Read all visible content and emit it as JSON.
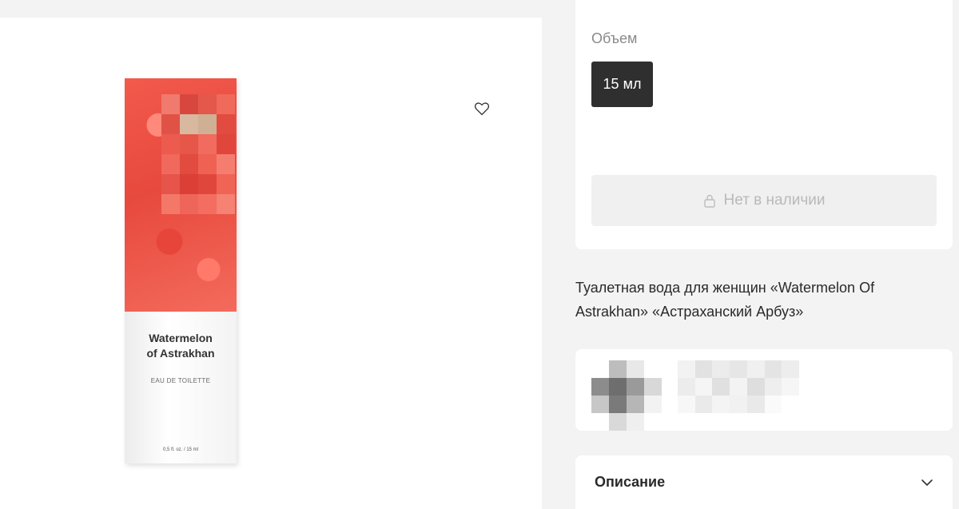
{
  "gallery": {
    "favorite_icon": "heart-outline-icon",
    "product_image": {
      "name_on_box": "Watermelon of Astrakhan",
      "name_line1": "Watermelon",
      "name_line2": "of Astrakhan",
      "type_on_box": "EAU DE TOILETTE",
      "volume_on_box": "0,5 fl. oz. / 15 ml"
    }
  },
  "purchase": {
    "volume_label": "Объем",
    "volume_options": [
      {
        "label": "15 мл",
        "selected": true
      }
    ],
    "stock_button": {
      "label": "Нет в наличии",
      "icon": "lock-icon",
      "disabled": true
    }
  },
  "product": {
    "title": "Туалетная вода для женщин «Watermelon Of Astrakhan» «Астраханский Арбуз»"
  },
  "description": {
    "label": "Описание",
    "icon": "chevron-down-icon"
  },
  "colors": {
    "chip_bg": "#2f2f2f",
    "button_disabled_bg": "#f0f0f0",
    "button_disabled_text": "#b9b9b9",
    "box_red": "#e7493d"
  }
}
